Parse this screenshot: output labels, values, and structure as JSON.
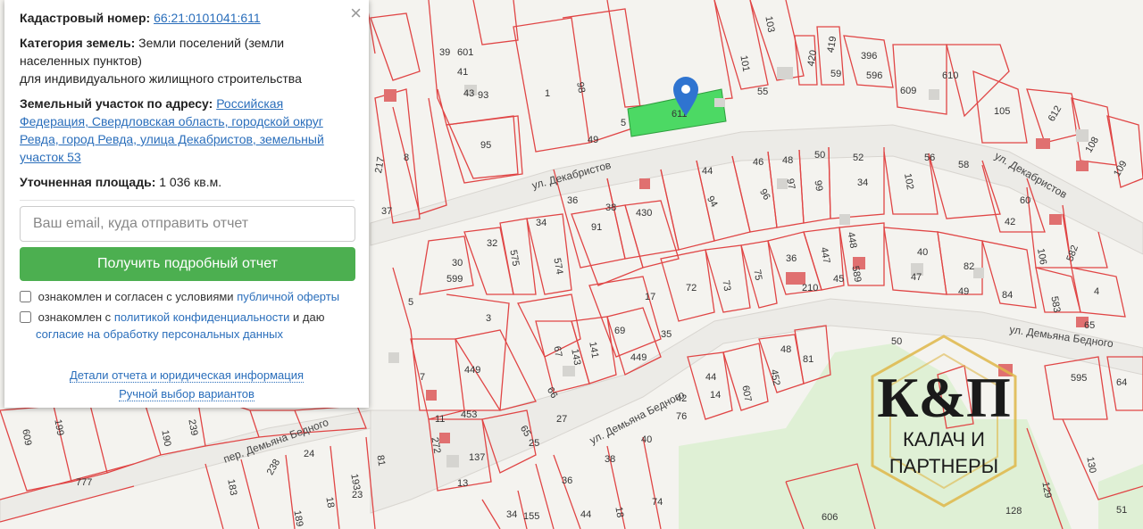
{
  "panel": {
    "cadastral_label": "Кадастровый номер:",
    "cadastral_value": "66:21:0101041:611",
    "category_label": "Категория земель:",
    "category_value": "Земли поселений (земли населенных пунктов)",
    "category_purpose": "для индивидуального жилищного строительства",
    "address_label": "Земельный участок по адресу:",
    "address_value": "Российская Федерация, Свердловская область, городской округ Ревда, город Ревда, улица Декабристов, земельный участок 53",
    "area_label": "Уточненная площадь:",
    "area_value": "1 036 кв.м.",
    "email_placeholder": "Ваш email, куда отправить отчет",
    "submit_label": "Получить подробный отчет",
    "consent1_text": "ознакомлен и согласен с условиями ",
    "consent1_link": "публичной оферты",
    "consent2_text": "ознакомлен с ",
    "consent2_link": "политикой конфиденциальности",
    "consent2_mid": " и даю",
    "consent2_link2": "согласие на обработку персональных данных",
    "details_link": "Детали отчета и юридическая информация",
    "manual_link": "Ручной выбор вариантов",
    "close_icon": "×"
  },
  "map": {
    "selected_parcel_label": "611",
    "selected_parcel_color": "#4cd964",
    "boundary_color": "#e04545",
    "streets": [
      "ул. Декабристов",
      "ул. Декабристов",
      "ул. Демьяна Бедного",
      "ул. Демьяна Бедного",
      "пер. Демьяна Бедного"
    ],
    "parcel_labels": [
      "39",
      "601",
      "41",
      "43",
      "93",
      "1",
      "98",
      "95",
      "49",
      "5",
      "103",
      "101",
      "55",
      "420",
      "419",
      "59",
      "396",
      "596",
      "610",
      "609",
      "105",
      "612",
      "108",
      "109",
      "217",
      "8",
      "37",
      "36",
      "44",
      "46",
      "48",
      "50",
      "52",
      "56",
      "58",
      "94",
      "96",
      "97",
      "99",
      "34",
      "102",
      "42",
      "106",
      "582",
      "60",
      "38",
      "430",
      "91",
      "34",
      "32",
      "575",
      "574",
      "599",
      "30",
      "5",
      "3",
      "17",
      "72",
      "73",
      "75",
      "36",
      "447",
      "448",
      "589",
      "210",
      "45",
      "40",
      "47",
      "82",
      "84",
      "583",
      "4",
      "65",
      "49",
      "7",
      "449",
      "67",
      "143",
      "141",
      "69",
      "35",
      "453",
      "66",
      "27",
      "11",
      "272",
      "65",
      "25",
      "137",
      "13",
      "449",
      "44",
      "42",
      "14",
      "76",
      "607",
      "48",
      "452",
      "81",
      "50",
      "595",
      "64",
      "609",
      "199",
      "777",
      "190",
      "239",
      "24",
      "238",
      "183",
      "193",
      "23",
      "18",
      "189",
      "81",
      "36",
      "155",
      "44",
      "18",
      "74",
      "40",
      "38",
      "34",
      "606",
      "130",
      "129",
      "128",
      "51"
    ],
    "logo_line1": "К&П",
    "logo_line2": "КАЛАЧ И",
    "logo_line3": "ПАРТНЕРЫ"
  }
}
